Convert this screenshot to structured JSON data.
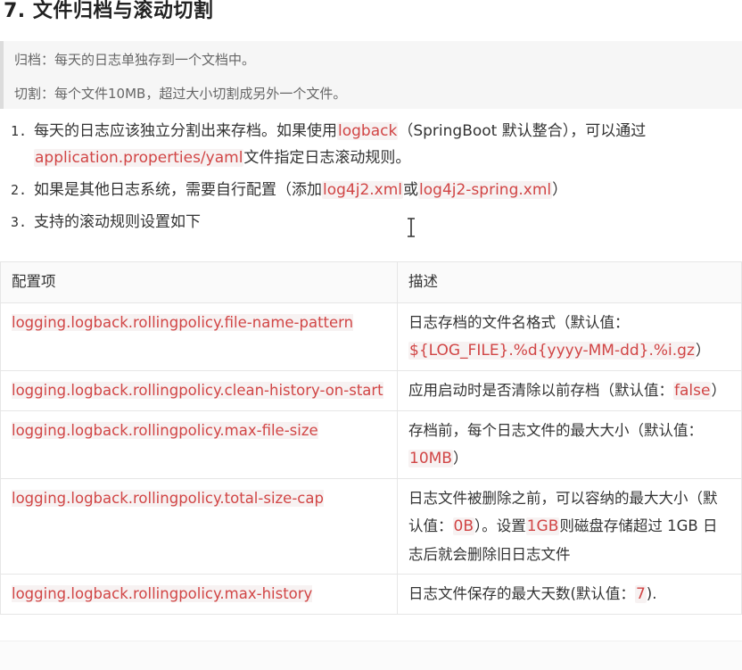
{
  "heading": "7. 文件归档与滚动切割",
  "quote": {
    "line1": "归档：每天的日志单独存到一个文档中。",
    "line2": "切割：每个文件10MB，超过大小切割成另外一个文件。"
  },
  "list": [
    {
      "num": "1.",
      "a": "每天的日志应该独立分割出来存档。如果使用",
      "code1": "logback",
      "b": "（SpringBoot 默认整合），可以通过",
      "code2": "application.properties/yaml",
      "c": "文件指定日志滚动规则。"
    },
    {
      "num": "2.",
      "a": "如果是其他日志系统，需要自行配置（添加",
      "code1": "log4j2.xml",
      "b": "或",
      "code2": "log4j2-spring.xml",
      "c": "）"
    },
    {
      "num": "3.",
      "a": "支持的滚动规则设置如下"
    }
  ],
  "table": {
    "headers": [
      "配置项",
      "描述"
    ],
    "rows": [
      {
        "key": "logging.logback.rollingpolicy.file-name-pattern",
        "desc_a": "日志存档的文件名格式（默认值：",
        "desc_code": "${LOG_FILE}.%d{yyyy-MM-dd}.%i.gz",
        "desc_b": "）"
      },
      {
        "key": "logging.logback.rollingpolicy.clean-history-on-start",
        "desc_a": "应用启动时是否清除以前存档（默认值：",
        "desc_code": "false",
        "desc_b": "）"
      },
      {
        "key": "logging.logback.rollingpolicy.max-file-size",
        "desc_a": "存档前，每个日志文件的最大大小（默认值：",
        "desc_code": "10MB",
        "desc_b": "）"
      },
      {
        "key": "logging.logback.rollingpolicy.total-size-cap",
        "desc_a": "日志文件被删除之前，可以容纳的最大大小（默认值：",
        "desc_code": "0B",
        "desc_b": "）。设置",
        "desc_code2": "1GB",
        "desc_c": "则磁盘存储超过 1GB 日志后就会删除旧日志文件"
      },
      {
        "key": "logging.logback.rollingpolicy.max-history",
        "desc_a": "日志文件保存的最大天数(默认值：",
        "desc_code": "7",
        "desc_b": ")."
      }
    ]
  }
}
